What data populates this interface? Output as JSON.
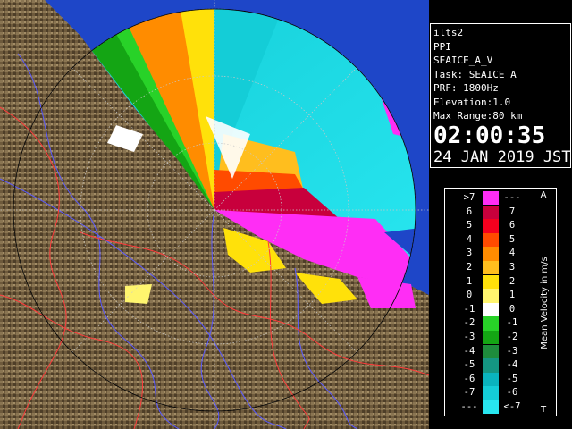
{
  "info": {
    "station": "ilts2",
    "mode": "PPI",
    "product": "SEAICE_A_V",
    "task": "Task: SEAICE_A",
    "prf": "PRF: 1800Hz",
    "elevation": "Elevation:1.0",
    "max_range": "Max Range:80 km",
    "time": "02:00:35",
    "date": "24 JAN 2019 JST"
  },
  "legend": {
    "title": "Mean Velocity in m/s",
    "top_mark": "A",
    "bottom_mark": "T",
    "rows": [
      {
        "lo": ">7",
        "hi": "---",
        "color": "#ff2df5"
      },
      {
        "lo": "6",
        "hi": "7",
        "color": "#c8003c"
      },
      {
        "lo": "5",
        "hi": "6",
        "color": "#f5001e"
      },
      {
        "lo": "4",
        "hi": "5",
        "color": "#ff4b00"
      },
      {
        "lo": "3",
        "hi": "4",
        "color": "#ff8c00"
      },
      {
        "lo": "2",
        "hi": "3",
        "color": "#ffbe1e"
      },
      {
        "lo": "1",
        "hi": "2",
        "color": "#ffe10a"
      },
      {
        "lo": "0",
        "hi": "1",
        "color": "#fff56e"
      },
      {
        "lo": "-1",
        "hi": "0",
        "color": "#ffffff"
      },
      {
        "lo": "-2",
        "hi": "-1",
        "color": "#28d228"
      },
      {
        "lo": "-3",
        "hi": "-2",
        "color": "#14a514"
      },
      {
        "lo": "-4",
        "hi": "-3",
        "color": "#1e8c3c"
      },
      {
        "lo": "-5",
        "hi": "-4",
        "color": "#149682"
      },
      {
        "lo": "-6",
        "hi": "-5",
        "color": "#0ab4be"
      },
      {
        "lo": "-7",
        "hi": "-6",
        "color": "#14cdd7"
      },
      {
        "lo": "---",
        "hi": "<-7",
        "color": "#28e6f0"
      }
    ]
  },
  "colors": {
    "sea": "#1e46c8",
    "land": "#6e5a3c",
    "radar_far": "#28e6f0",
    "radar_pink": "#ff2df5"
  }
}
